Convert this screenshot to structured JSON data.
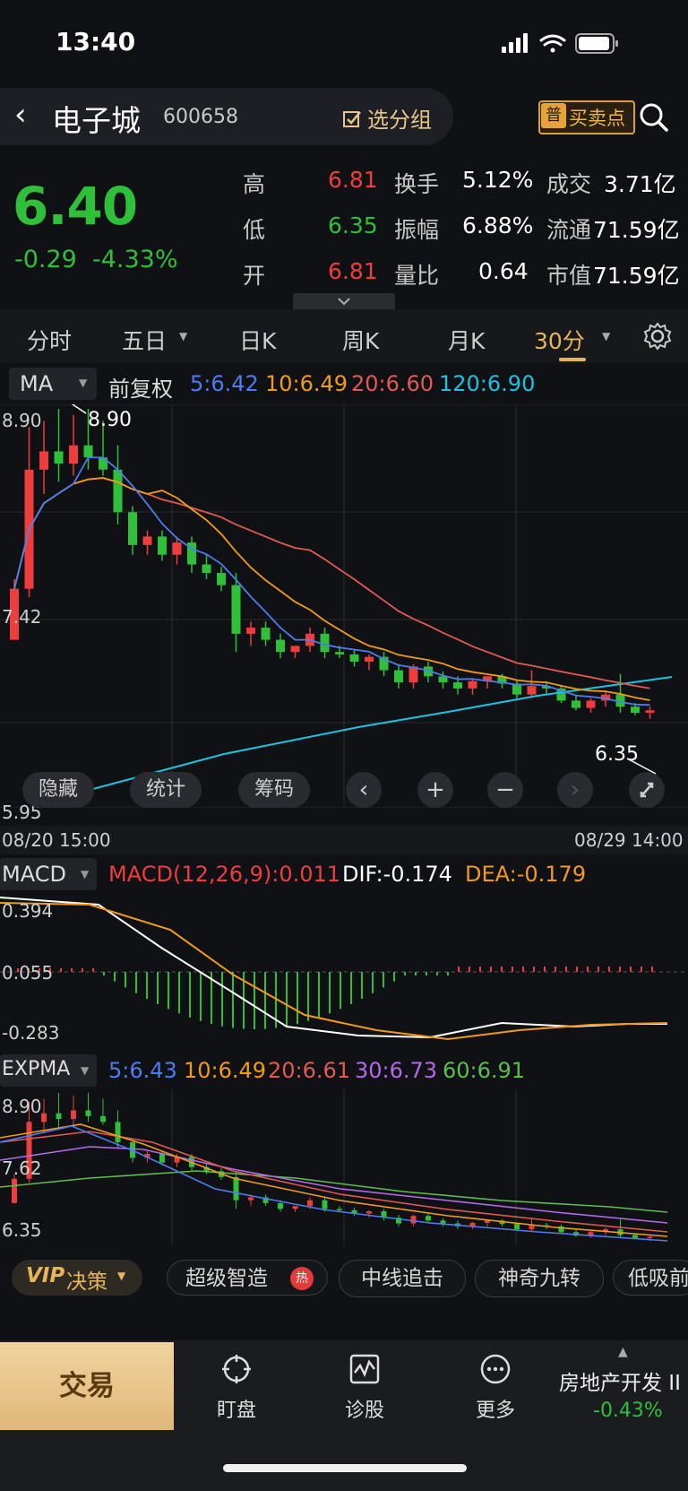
{
  "status": {
    "time": "13:40"
  },
  "header": {
    "stock_name": "电子城",
    "stock_code": "600658",
    "group_label": "选分组",
    "bs_icon": "普",
    "bs_label": "买卖点"
  },
  "quote": {
    "price": "6.40",
    "change": "-0.29",
    "change_pct": "-4.33%",
    "stats": [
      {
        "k": "高",
        "v": "6.81",
        "k2": "换手",
        "v2": "5.12%",
        "k3": "成交",
        "v3": "3.71亿"
      },
      {
        "k": "低",
        "v": "6.35",
        "k2": "振幅",
        "v2": "6.88%",
        "k3": "流通",
        "v3": "71.59亿"
      },
      {
        "k": "开",
        "v": "6.81",
        "k2": "量比",
        "v2": "0.64",
        "k3": "市值",
        "v3": "71.59亿"
      }
    ]
  },
  "tabs": {
    "t1": "分时",
    "t2": "五日",
    "t3": "日K",
    "t4": "周K",
    "t5": "月K",
    "t6": "30分"
  },
  "ma": {
    "type": "MA",
    "adj": "前复权",
    "ma5": "5:6.42",
    "ma10": "10:6.49",
    "ma20": "20:6.60",
    "ma120": "120:6.90"
  },
  "chart_axes": {
    "y_top": "8.90",
    "y_mid": "7.42",
    "y_bot": "5.95",
    "high_label": "8.90",
    "low_label": "6.35",
    "x_start": "08/20 15:00",
    "x_end": "08/29 14:00"
  },
  "controls": {
    "hide": "隐藏",
    "stats": "统计",
    "chips": "筹码",
    "prev": "‹",
    "plus": "+",
    "minus": "−",
    "next": "›"
  },
  "macd": {
    "name": "MACD",
    "macd_val": "MACD(12,26,9):0.011",
    "dif": "DIF:-0.174",
    "dea": "DEA:-0.179",
    "y_top": "0.394",
    "y_mid": "0.055",
    "y_bot": "-0.283"
  },
  "expma": {
    "name": "EXPMA",
    "e5": "5:6.43",
    "e10": "10:6.49",
    "e20": "20:6.61",
    "e30": "30:6.73",
    "e60": "60:6.91",
    "y_top": "8.90",
    "y_mid": "7.62",
    "y_bot": "6.35"
  },
  "strategy": {
    "vip": "VIP",
    "vip_label": "决策",
    "chips": [
      "超级智造",
      "中线追击",
      "神奇九转",
      "低吸前"
    ],
    "hot": "热"
  },
  "bottom_nav": {
    "trade": "交易",
    "watch": "盯盘",
    "diagnose": "诊股",
    "more": "更多",
    "sector_name": "房地产开发 II",
    "sector_change": "-0.43%"
  },
  "colors": {
    "up": "#ee3d3d",
    "down": "#2fbf3a",
    "accent": "#e8b45a",
    "ma5": "#4d7cf0",
    "ma10": "#f19a1c",
    "ma20": "#e05a52",
    "ma120": "#1ec2e0"
  },
  "chart_data": {
    "type": "candlestick",
    "candles": [
      {
        "o": 7.0,
        "h": 7.5,
        "l": 7.0,
        "c": 7.42
      },
      {
        "o": 7.42,
        "h": 8.75,
        "l": 7.35,
        "c": 8.4
      },
      {
        "o": 8.4,
        "h": 8.8,
        "l": 8.2,
        "c": 8.55
      },
      {
        "o": 8.55,
        "h": 8.9,
        "l": 8.3,
        "c": 8.45
      },
      {
        "o": 8.45,
        "h": 8.85,
        "l": 8.35,
        "c": 8.6
      },
      {
        "o": 8.6,
        "h": 8.9,
        "l": 8.4,
        "c": 8.5
      },
      {
        "o": 8.5,
        "h": 8.8,
        "l": 8.35,
        "c": 8.4
      },
      {
        "o": 8.4,
        "h": 8.6,
        "l": 7.95,
        "c": 8.05
      },
      {
        "o": 8.05,
        "h": 8.1,
        "l": 7.7,
        "c": 7.78
      },
      {
        "o": 7.78,
        "h": 7.9,
        "l": 7.7,
        "c": 7.85
      },
      {
        "o": 7.85,
        "h": 7.9,
        "l": 7.65,
        "c": 7.7
      },
      {
        "o": 7.7,
        "h": 7.85,
        "l": 7.62,
        "c": 7.8
      },
      {
        "o": 7.8,
        "h": 7.85,
        "l": 7.55,
        "c": 7.62
      },
      {
        "o": 7.62,
        "h": 7.7,
        "l": 7.5,
        "c": 7.55
      },
      {
        "o": 7.55,
        "h": 7.6,
        "l": 7.4,
        "c": 7.45
      },
      {
        "o": 7.45,
        "h": 7.55,
        "l": 6.9,
        "c": 7.05
      },
      {
        "o": 7.05,
        "h": 7.15,
        "l": 6.95,
        "c": 7.1
      },
      {
        "o": 7.1,
        "h": 7.15,
        "l": 6.95,
        "c": 7.0
      },
      {
        "o": 7.0,
        "h": 7.05,
        "l": 6.85,
        "c": 6.9
      },
      {
        "o": 6.9,
        "h": 6.95,
        "l": 6.85,
        "c": 6.95
      },
      {
        "o": 6.95,
        "h": 7.1,
        "l": 6.9,
        "c": 7.05
      },
      {
        "o": 7.05,
        "h": 7.1,
        "l": 6.85,
        "c": 6.9
      },
      {
        "o": 6.9,
        "h": 6.95,
        "l": 6.85,
        "c": 6.88
      },
      {
        "o": 6.88,
        "h": 6.92,
        "l": 6.78,
        "c": 6.82
      },
      {
        "o": 6.82,
        "h": 6.88,
        "l": 6.75,
        "c": 6.86
      },
      {
        "o": 6.86,
        "h": 6.9,
        "l": 6.7,
        "c": 6.75
      },
      {
        "o": 6.75,
        "h": 6.8,
        "l": 6.6,
        "c": 6.65
      },
      {
        "o": 6.65,
        "h": 6.8,
        "l": 6.6,
        "c": 6.78
      },
      {
        "o": 6.78,
        "h": 6.82,
        "l": 6.65,
        "c": 6.7
      },
      {
        "o": 6.7,
        "h": 6.74,
        "l": 6.6,
        "c": 6.65
      },
      {
        "o": 6.65,
        "h": 6.7,
        "l": 6.55,
        "c": 6.6
      },
      {
        "o": 6.6,
        "h": 6.68,
        "l": 6.55,
        "c": 6.66
      },
      {
        "o": 6.66,
        "h": 6.7,
        "l": 6.6,
        "c": 6.7
      },
      {
        "o": 6.7,
        "h": 6.72,
        "l": 6.6,
        "c": 6.64
      },
      {
        "o": 6.64,
        "h": 6.66,
        "l": 6.52,
        "c": 6.55
      },
      {
        "o": 6.55,
        "h": 6.75,
        "l": 6.52,
        "c": 6.62
      },
      {
        "o": 6.62,
        "h": 6.66,
        "l": 6.55,
        "c": 6.6
      },
      {
        "o": 6.6,
        "h": 6.63,
        "l": 6.48,
        "c": 6.5
      },
      {
        "o": 6.5,
        "h": 6.55,
        "l": 6.42,
        "c": 6.44
      },
      {
        "o": 6.44,
        "h": 6.52,
        "l": 6.4,
        "c": 6.5
      },
      {
        "o": 6.5,
        "h": 6.58,
        "l": 6.45,
        "c": 6.55
      },
      {
        "o": 6.55,
        "h": 6.72,
        "l": 6.4,
        "c": 6.45
      },
      {
        "o": 6.45,
        "h": 6.48,
        "l": 6.38,
        "c": 6.4
      },
      {
        "o": 6.4,
        "h": 6.45,
        "l": 6.35,
        "c": 6.42
      }
    ]
  }
}
